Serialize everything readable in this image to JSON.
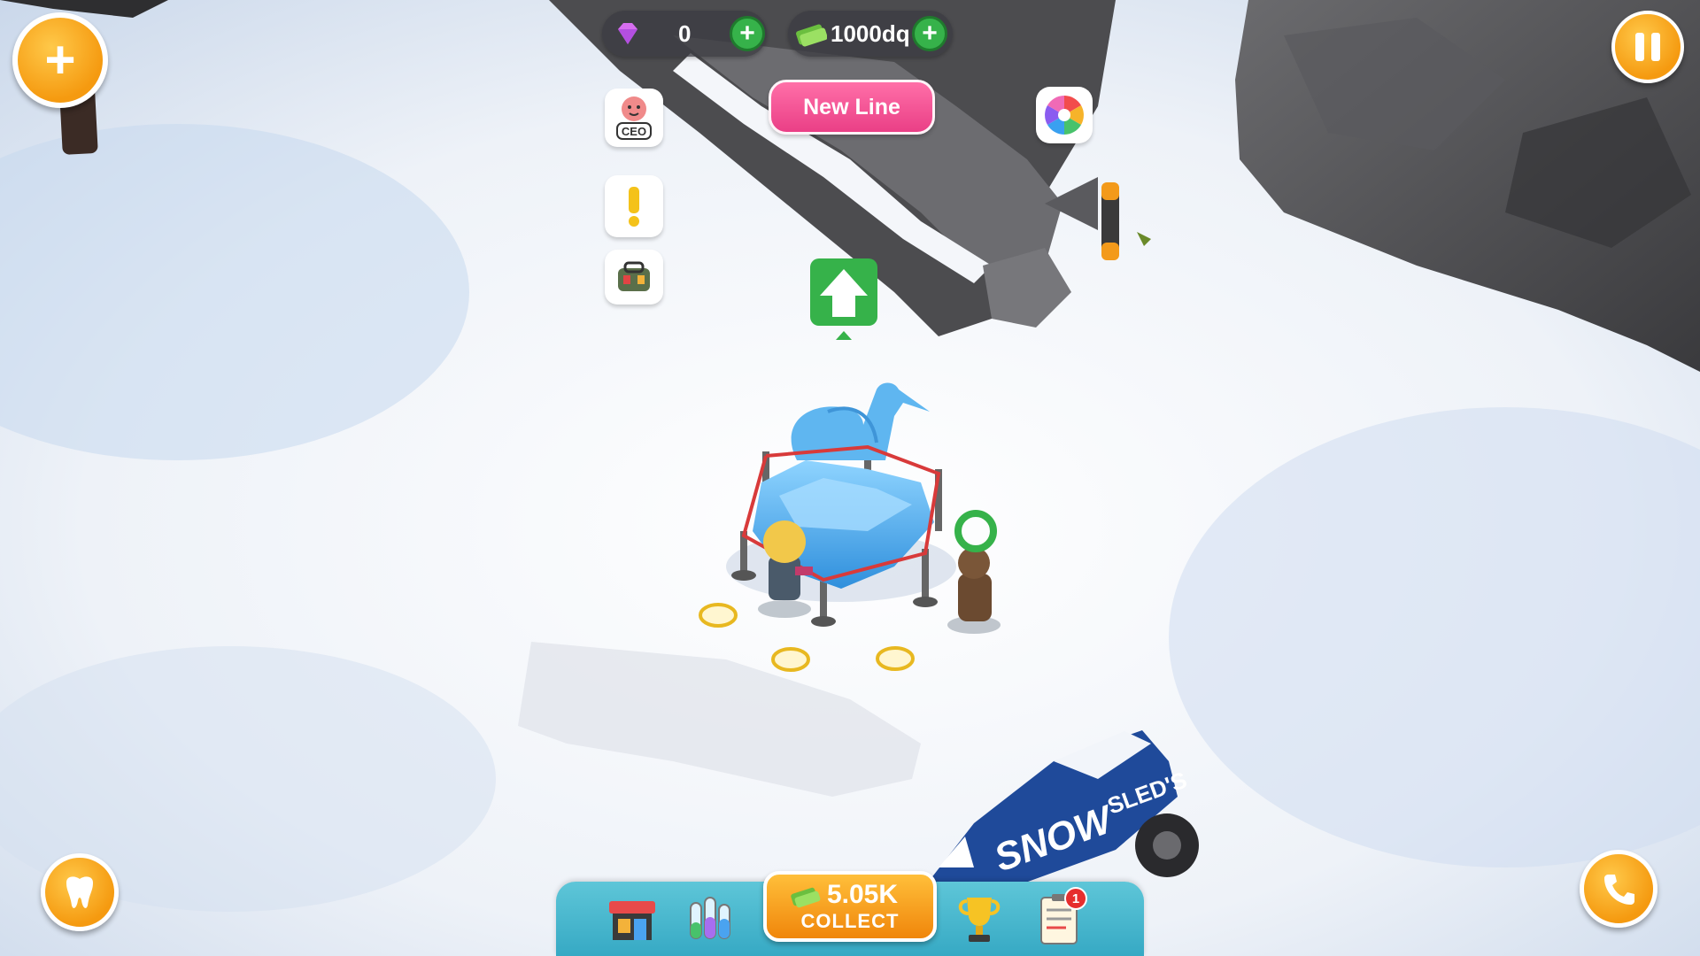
{
  "hud": {
    "gems_value": "0",
    "cash_value": "1000dq"
  },
  "banner": {
    "new_line_label": "New Line"
  },
  "side_buttons": {
    "ceo_label": "CEO"
  },
  "collect": {
    "amount": "5.05K",
    "label": "COLLECT"
  },
  "car": {
    "text": "SNOW",
    "text2": "SLED'S"
  },
  "bottom_bar": {
    "task_badge": "1"
  },
  "colors": {
    "orange": "#f59a10",
    "green": "#36b24a",
    "pink": "#ea3f86",
    "teal": "#36a9c4",
    "ice": "#4fb1ee"
  }
}
